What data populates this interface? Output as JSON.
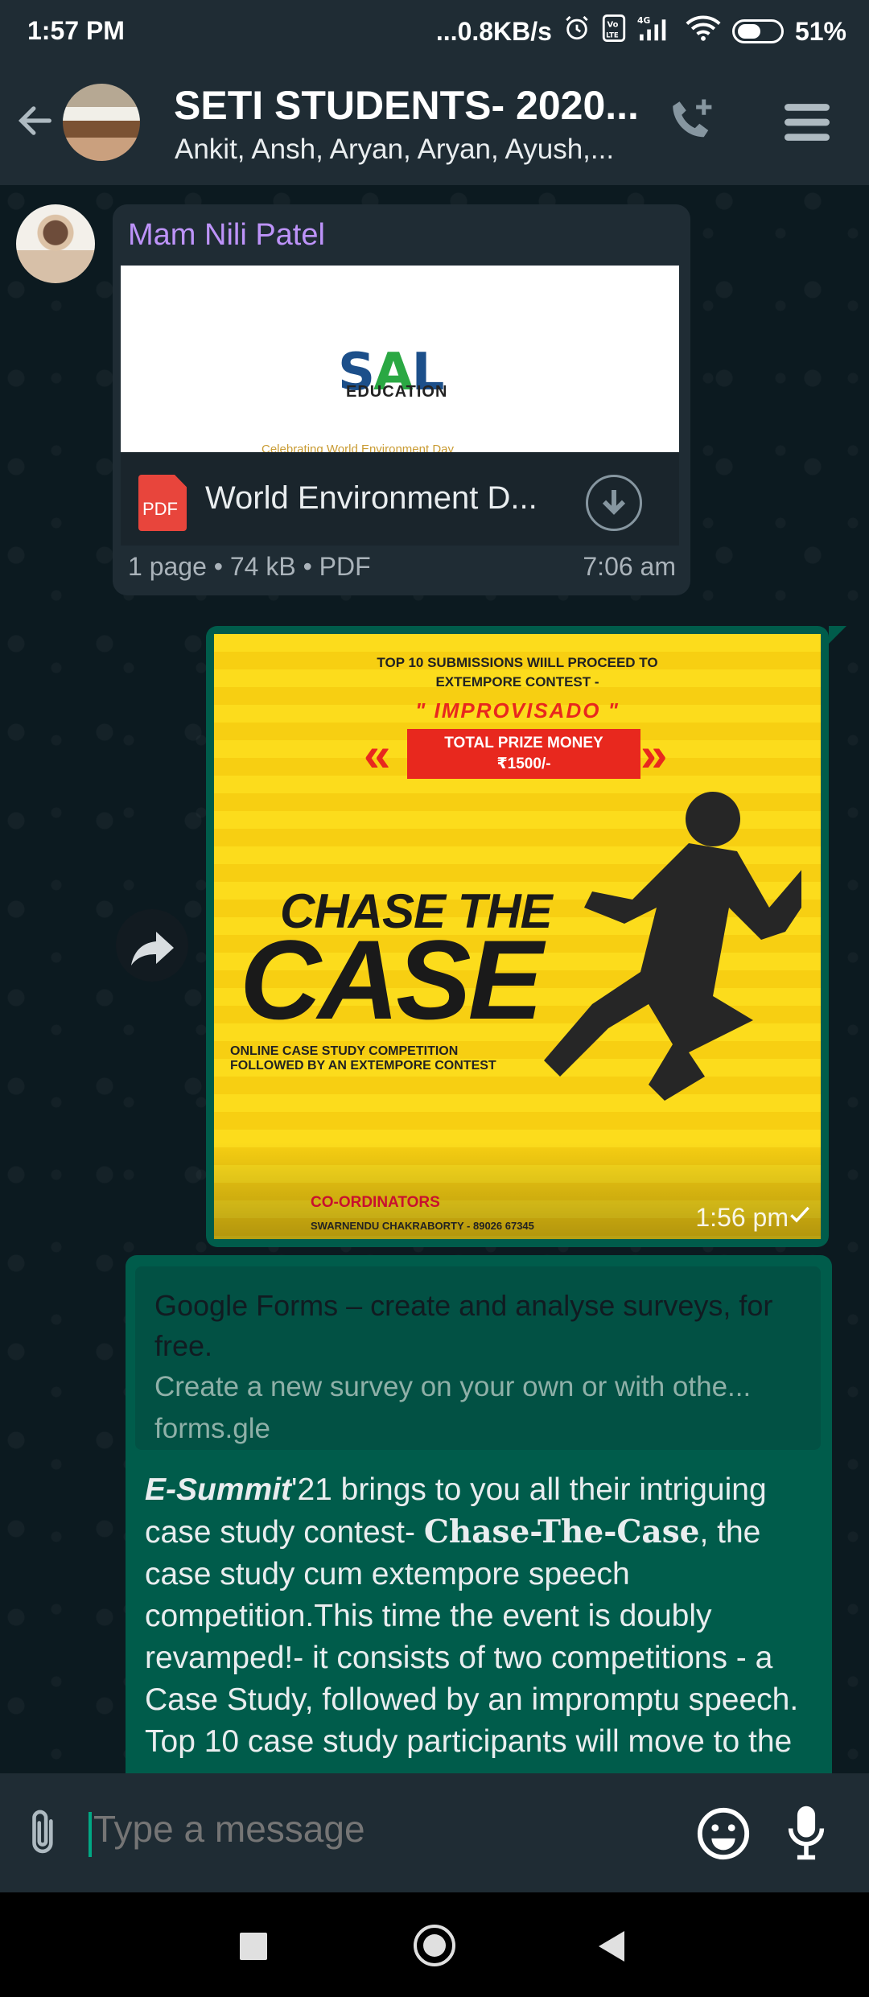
{
  "status_bar": {
    "time": "1:57 PM",
    "net_speed": "...0.8KB/s",
    "battery": "51%"
  },
  "header": {
    "title": "SETI STUDENTS- 2020...",
    "subtitle": "Ankit, Ansh, Aryan, Aryan, Ayush,..."
  },
  "messages": {
    "doc": {
      "sender": "Mam Nili Patel",
      "preview_logo": "SAL",
      "preview_logo_sub": "EDUCATION",
      "preview_cut_text": "Celebrating World Environment Day",
      "icon_label": "PDF",
      "file_name": "World Environment D...",
      "meta": "1 page • 74 kB • PDF",
      "time": "7:06 am"
    },
    "poster": {
      "top_line1": "TOP 10 SUBMISSIONS WIILL PROCEED TO",
      "top_line2": "EXTEMPORE CONTEST -",
      "contest": "\" IMPROVISADO \"",
      "prize_line1": "TOTAL PRIZE MONEY",
      "prize_line2": "₹1500/-",
      "headline1": "CHASE THE",
      "headline2": "CASE",
      "online_line1": "ONLINE CASE STUDY COMPETITION",
      "online_line2": "FOLLOWED BY AN EXTEMPORE CONTEST",
      "coordinators": "CO-ORDINATORS",
      "coordinator_names": "SWARNENDU CHAKRABORTY - 89026 67345",
      "time": "1:56 pm"
    },
    "link": {
      "card_title": "Google Forms – create and analyse surveys, for free.",
      "card_desc": "Create a new survey on your own or with othe...",
      "card_url": "forms.gle",
      "text_bold": "E-Summit",
      "text_part1": "'21 brings to you all their intriguing case study contest-",
      "text_serif": "Chase-The-Case",
      "text_part2": ", the case study cum extempore speech competition.This time the event is doubly revamped!- it consists of two competitions -  a Case Study, followed by an impromptu speech. Top 10 case study participants will move to the"
    }
  },
  "composer": {
    "placeholder": "Type a message"
  },
  "icons": {
    "back": "arrow-left-icon",
    "call": "add-call-icon",
    "menu": "hamburger-menu-icon",
    "download": "download-icon",
    "share": "forward-icon",
    "attach": "paperclip-icon",
    "emoji": "smiley-icon",
    "mic": "microphone-icon"
  },
  "colors": {
    "bar_bg": "#1f2c34",
    "incoming_bubble": "#1f2c34",
    "outgoing_bubble": "#005c4b",
    "sender_name": "#bd93f9",
    "accent": "#00a884"
  }
}
